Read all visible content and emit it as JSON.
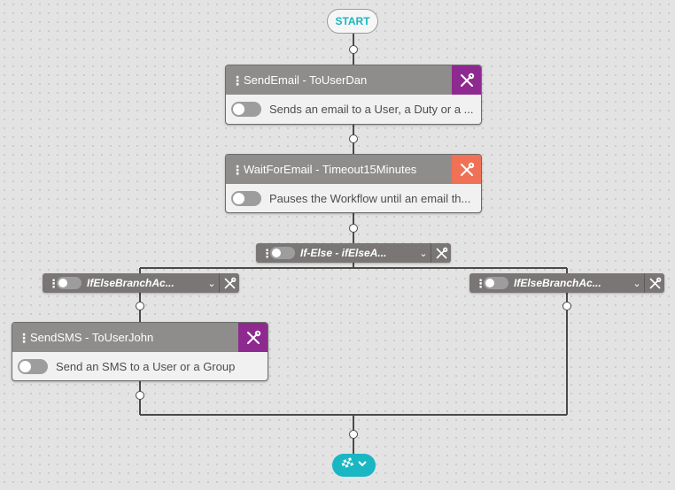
{
  "start_label": "START",
  "colors": {
    "accent_teal": "#19b6c4",
    "tool_purple": "#8e2a8f",
    "tool_orange": "#f07155",
    "card_header": "#8f8c8c",
    "bar_gray": "#7a7676"
  },
  "nodes": {
    "send_email": {
      "title": "SendEmail - ToUserDan",
      "description": "Sends an email to a User, a Duty or a ...",
      "icon": "tools-icon"
    },
    "wait_for_email": {
      "title": "WaitForEmail - Timeout15Minutes",
      "description": "Pauses the Workflow until an email th...",
      "icon": "tools-icon"
    },
    "if_else": {
      "label": "If-Else - ifElseA..."
    },
    "branch_left": {
      "label": "IfElseBranchAc..."
    },
    "branch_right": {
      "label": "IfElseBranchAc..."
    },
    "send_sms": {
      "title": "SendSMS - ToUserJohn",
      "description": "Send an SMS to a User or a Group",
      "icon": "tools-icon"
    }
  },
  "end_control": {
    "icon": "finish-flag-icon",
    "dropdown_icon": "chevron-down-icon"
  }
}
